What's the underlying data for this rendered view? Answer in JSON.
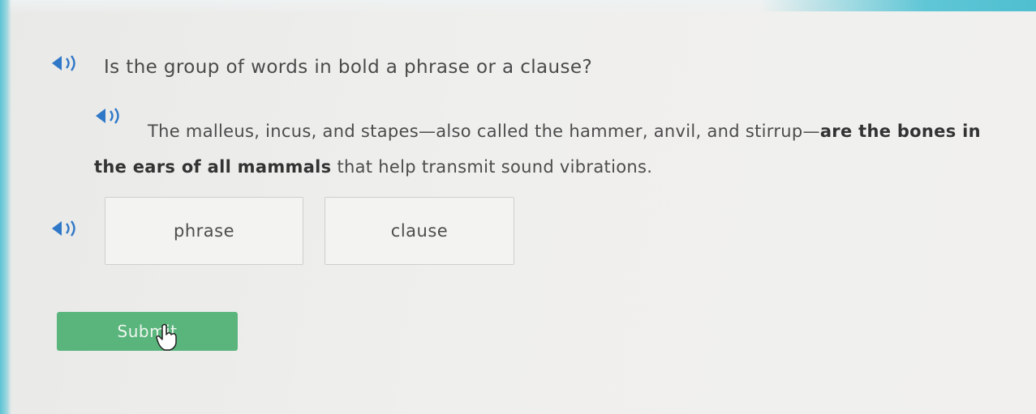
{
  "question": {
    "text": "Is the group of words in bold a phrase or a clause?",
    "audio_icon": "speaker-icon"
  },
  "passage": {
    "text_before": "The malleus, incus, and stapes—also called the hammer, anvil, and stirrup—",
    "bold_text": "are the bones in the ears of all mammals",
    "text_after": " that help transmit sound vibrations.",
    "audio_icon": "speaker-icon"
  },
  "choices": {
    "audio_icon": "speaker-icon",
    "items": [
      {
        "label": "phrase"
      },
      {
        "label": "clause"
      }
    ]
  },
  "submit": {
    "label": "Submit"
  },
  "colors": {
    "submit_green": "#5ab57c",
    "speaker_blue": "#2f78c8",
    "accent_teal": "#5fc6d6"
  }
}
